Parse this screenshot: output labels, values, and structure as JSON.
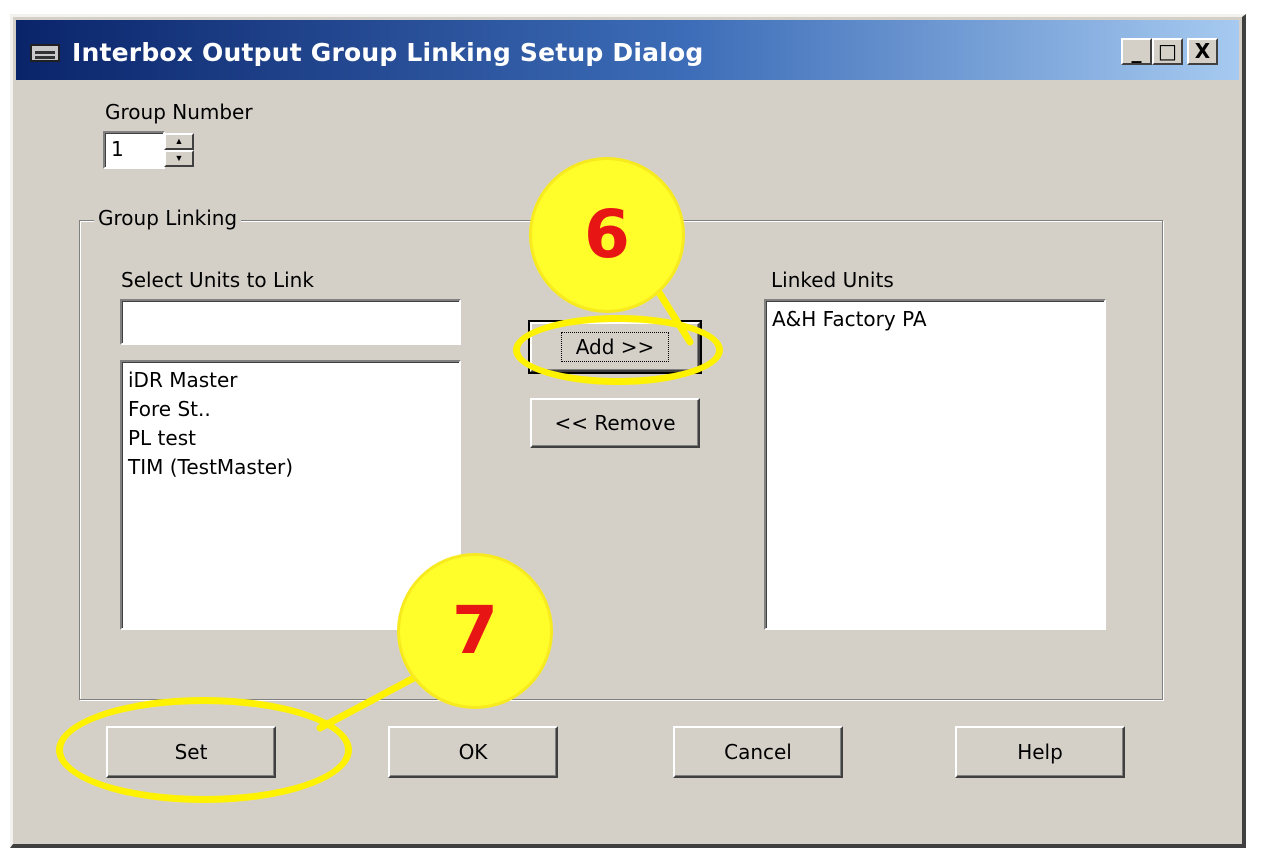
{
  "window": {
    "title": "Interbox Output Group Linking Setup Dialog",
    "minimize_glyph": "_",
    "maximize_glyph": "□",
    "close_glyph": "X"
  },
  "group_number": {
    "label": "Group Number",
    "value": "1",
    "up_glyph": "▲",
    "down_glyph": "▼"
  },
  "group_linking": {
    "legend": "Group Linking",
    "select_label": "Select Units to Link",
    "filter_value": "",
    "available_units": [
      "iDR Master",
      "Fore St..",
      "PL test",
      "TIM (TestMaster)"
    ],
    "linked_label": "Linked Units",
    "linked_units": [
      "A&H Factory PA"
    ],
    "add_label": "Add >>",
    "remove_label": "<< Remove"
  },
  "buttons": {
    "set": "Set",
    "ok": "OK",
    "cancel": "Cancel",
    "help": "Help"
  },
  "callouts": {
    "step_add": "6",
    "step_set": "7"
  },
  "colors": {
    "titlebar_start": "#0a246a",
    "titlebar_end": "#a6caf0",
    "dialog_face": "#d4d0c8",
    "callout_fill": "#fffd2a",
    "callout_number": "#e81515",
    "highlight_ring": "#fff200"
  }
}
